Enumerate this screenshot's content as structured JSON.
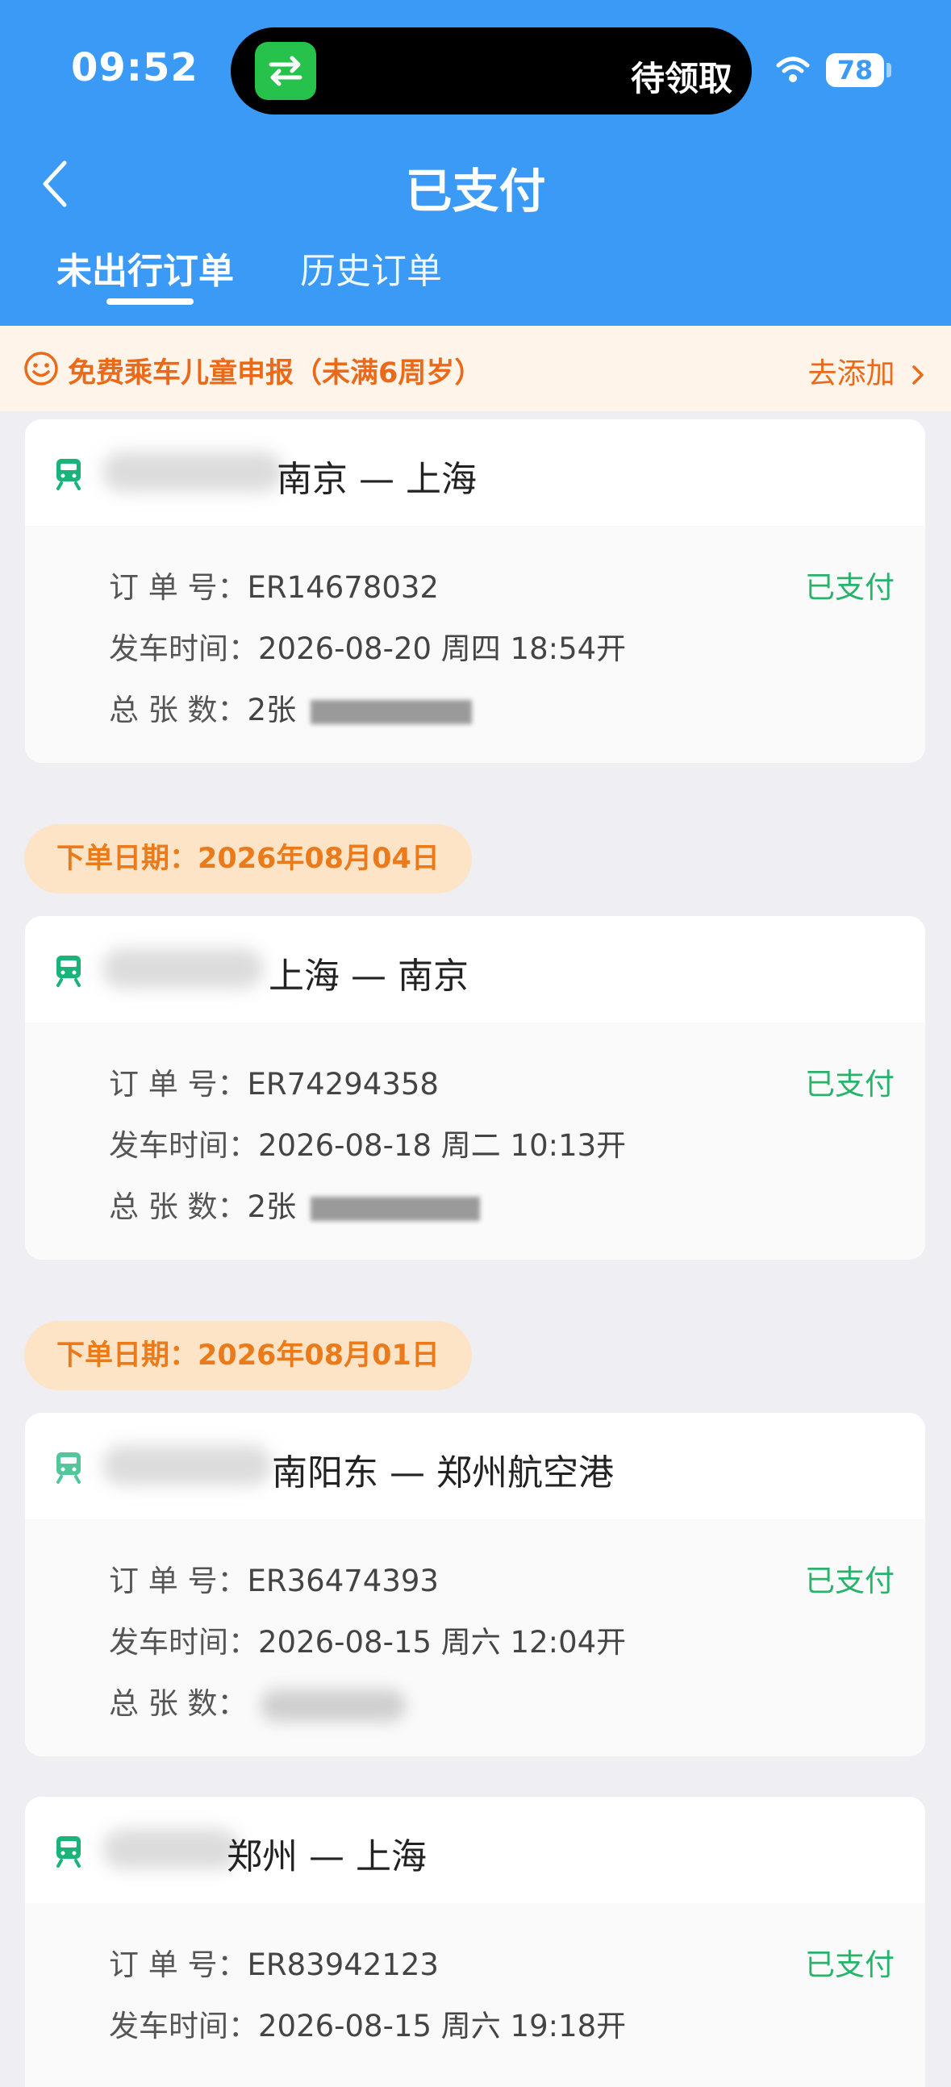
{
  "status_bar": {
    "time": "09:52",
    "island_text": "待领取",
    "battery": "78"
  },
  "header": {
    "title": "已支付",
    "tabs": [
      {
        "label": "未出行订单"
      },
      {
        "label": "历史订单"
      }
    ]
  },
  "notice": {
    "text": "免费乘车儿童申报（未满6周岁）",
    "action": "去添加"
  },
  "orders": [
    {
      "route": "南京 — 上海",
      "order_no_label": "订 单 号：",
      "order_no": "ER14678032",
      "status": "已支付",
      "depart_label": "发车时间：",
      "depart": "2026-08-20  周四  18:54开",
      "count_label": "总 张 数：",
      "count": "2张"
    },
    {
      "order_date": "下单日期：2026年08月04日",
      "route": "上海 — 南京",
      "order_no_label": "订 单 号：",
      "order_no": "ER74294358",
      "status": "已支付",
      "depart_label": "发车时间：",
      "depart": "2026-08-18  周二  10:13开",
      "count_label": "总 张 数：",
      "count": "2张"
    },
    {
      "order_date": "下单日期：2026年08月01日",
      "route": "南阳东 — 郑州航空港",
      "order_no_label": "订 单 号：",
      "order_no": "ER36474393",
      "status": "已支付",
      "depart_label": "发车时间：",
      "depart": "2026-08-15  周六  12:04开",
      "count_label": "总 张 数：",
      "count": ""
    },
    {
      "route": "郑州 — 上海",
      "order_no_label": "订 单 号：",
      "order_no": "ER83942123",
      "status": "已支付",
      "depart_label": "发车时间：",
      "depart": "2026-08-15  周六  19:18开"
    }
  ]
}
